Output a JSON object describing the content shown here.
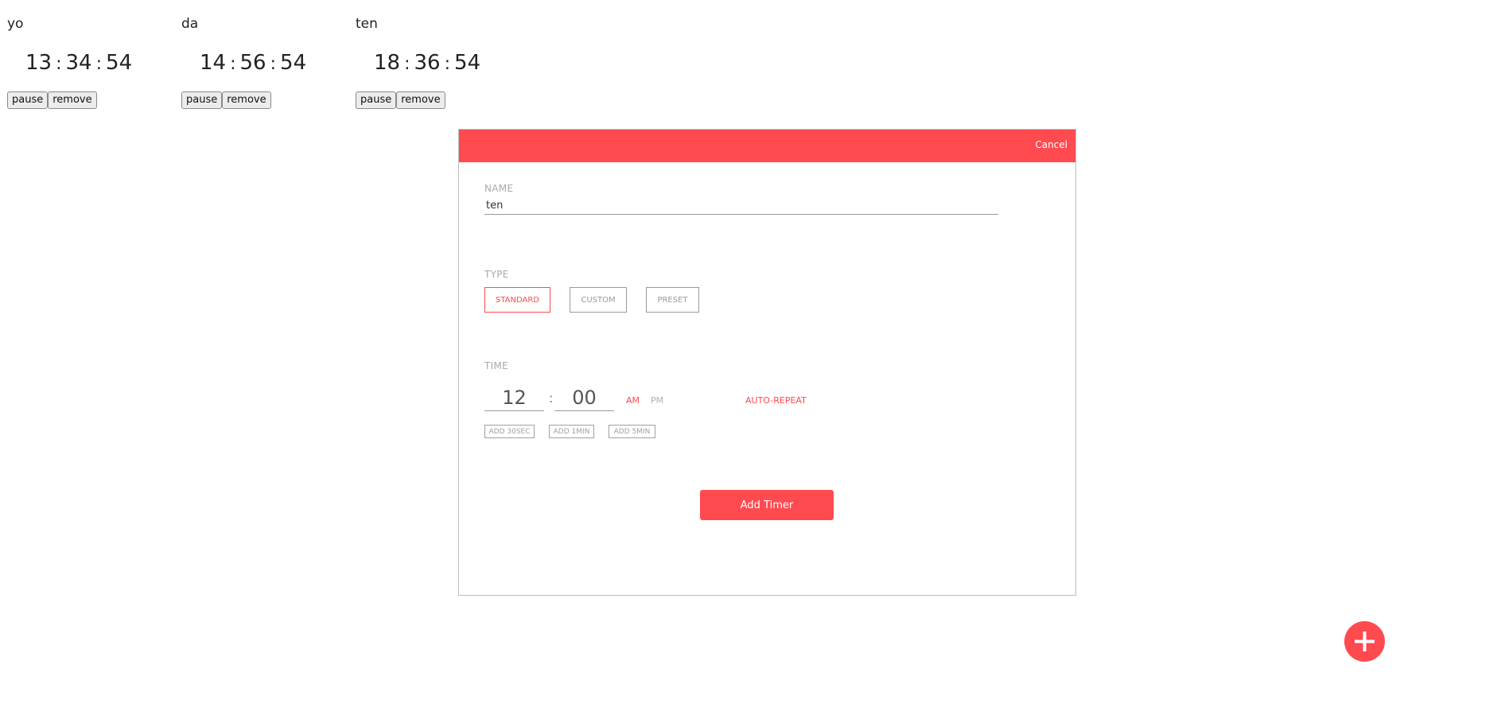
{
  "timers": [
    {
      "name": "yo",
      "hours": "13",
      "minutes": "34",
      "seconds": "54",
      "pause_label": "pause",
      "remove_label": "remove"
    },
    {
      "name": "da",
      "hours": "14",
      "minutes": "56",
      "seconds": "54",
      "pause_label": "pause",
      "remove_label": "remove"
    },
    {
      "name": "ten",
      "hours": "18",
      "minutes": "36",
      "seconds": "54",
      "pause_label": "pause",
      "remove_label": "remove"
    }
  ],
  "time_separator": ":",
  "modal": {
    "cancel_label": "Cancel",
    "name_section": {
      "label": "NAME",
      "value": "ten"
    },
    "type_section": {
      "label": "TYPE",
      "options": [
        "STANDARD",
        "CUSTOM",
        "PRESET"
      ],
      "selected": "STANDARD"
    },
    "time_section": {
      "label": "TIME",
      "hours": "12",
      "minutes": "00",
      "colon": ":",
      "am_label": "AM",
      "pm_label": "PM",
      "selected_period": "AM",
      "auto_repeat_label": "AUTO-REPEAT",
      "add_buttons": [
        "ADD 30SEC",
        "ADD 1MIN",
        "ADD 5MIN"
      ]
    },
    "submit_label": "Add Timer"
  },
  "fab": {
    "icon": "plus-icon"
  },
  "colors": {
    "accent": "#ff4a4f",
    "muted": "#a9a9a9",
    "text": "#222222"
  }
}
